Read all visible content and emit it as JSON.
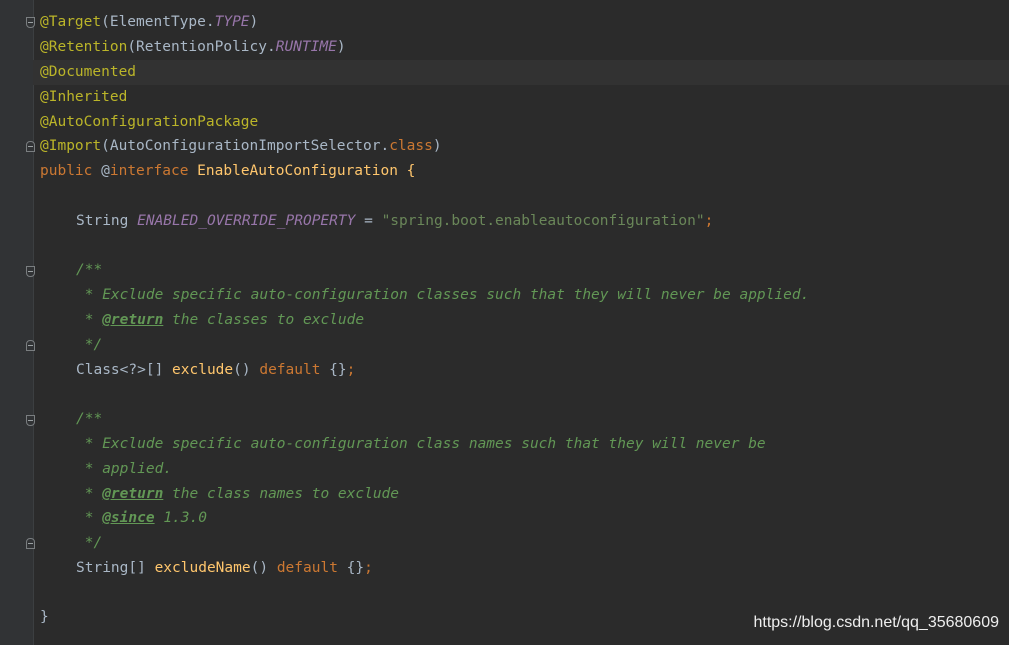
{
  "editor": {
    "line1": {
      "ann": "@Target",
      "p1": "(ElementType.",
      "const": "TYPE",
      "p2": ")"
    },
    "line2": {
      "ann": "@Retention",
      "p1": "(RetentionPolicy.",
      "const": "RUNTIME",
      "p2": ")"
    },
    "line3": {
      "ann": "@Documented"
    },
    "line4": {
      "ann": "@Inherited"
    },
    "line5": {
      "ann": "@AutoConfigurationPackage"
    },
    "line6": {
      "ann": "@Import",
      "p1": "(AutoConfigurationImportSelector.",
      "kw": "class",
      "p2": ")"
    },
    "line7": {
      "kw1": "public",
      "ann": " @",
      "kw2": "interface",
      "name": " EnableAutoConfiguration {"
    },
    "line8": {
      "type": "String ",
      "const": "ENABLED_OVERRIDE_PROPERTY",
      "eq": " = ",
      "str": "\"spring.boot.enableautoconfiguration\"",
      "semi": ";"
    },
    "doc1": {
      "open": "/**",
      "l1": " * Exclude specific auto-configuration classes such that they will never be applied.",
      "l2_prefix": " * ",
      "l2_tag": "@return",
      "l2_text": " the classes to exclude",
      "close": " */"
    },
    "decl1": {
      "type": "Class<?>[] ",
      "fn": "exclude",
      "paren": "() ",
      "kw": "default",
      "rest": " {}",
      "semi": ";"
    },
    "doc2": {
      "open": "/**",
      "l1": " * Exclude specific auto-configuration class names such that they will never be",
      "l2": " * applied.",
      "l3_prefix": " * ",
      "l3_tag": "@return",
      "l3_text": " the class names to exclude",
      "l4_prefix": " * ",
      "l4_tag": "@since",
      "l4_text": " 1.3.0",
      "close": " */"
    },
    "decl2": {
      "type": "String[] ",
      "fn": "excludeName",
      "paren": "() ",
      "kw": "default",
      "rest": " {}",
      "semi": ";"
    },
    "closing_brace": "}"
  },
  "watermark": "https://blog.csdn.net/qq_35680609",
  "colors": {
    "background": "#2b2b2b",
    "annotation": "#bbb529",
    "keyword": "#cc7832",
    "static_field": "#9876aa",
    "string": "#6a8759",
    "method": "#ffc66d",
    "doc_comment": "#629755",
    "text": "#a9b7c6"
  },
  "icons": [
    "fold-start-icon",
    "fold-end-icon"
  ]
}
